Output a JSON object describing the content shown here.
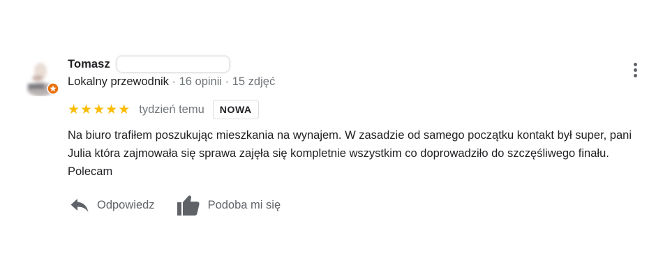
{
  "reviewer": {
    "name": "Tomasz",
    "level": "Lokalny przewodnik",
    "separator": " · ",
    "reviews_count": "16 opinii",
    "photos_count": "15 zdjęć"
  },
  "rating": {
    "stars": 5,
    "max": 5,
    "star_char": "★",
    "time_ago": "tydzień temu",
    "badge": "NOWA"
  },
  "review": {
    "text": "Na biuro trafiłem poszukując mieszkania na wynajem. W zasadzie od samego początku kontakt był super, pani Julia która zajmowała się sprawa zajęła się kompletnie wszystkim co doprowadziło do szczęśliwego finału. Polecam"
  },
  "actions": {
    "reply_label": "Odpowiedz",
    "like_label": "Podoba mi się"
  },
  "colors": {
    "star": "#fbbc04",
    "local_guide_badge": "#e8710a"
  }
}
